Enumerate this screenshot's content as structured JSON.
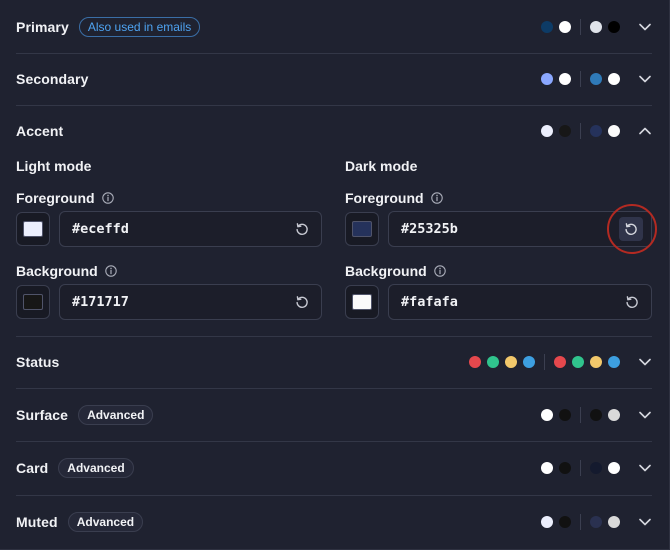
{
  "rows": {
    "primary": {
      "title": "Primary",
      "badge": "Also used in emails",
      "swatches_light": [
        "#0d3b66",
        "#ffffff"
      ],
      "swatches_dark": [
        "#dfe3ea",
        "#000000"
      ]
    },
    "secondary": {
      "title": "Secondary",
      "swatches_light": [
        "#8ba8ff",
        "#ffffff"
      ],
      "swatches_dark": [
        "#2f7ab8",
        "#ffffff"
      ]
    },
    "accent": {
      "title": "Accent",
      "swatches_light": [
        "#eceffd",
        "#171717"
      ],
      "swatches_dark": [
        "#25325b",
        "#fafafa"
      ],
      "expanded": true
    },
    "status": {
      "title": "Status",
      "swatches_light": [
        "#e5484d",
        "#30c48d",
        "#f2c86b",
        "#3d9fe0"
      ],
      "swatches_dark": [
        "#e5484d",
        "#30c48d",
        "#f2c86b",
        "#3d9fe0"
      ]
    },
    "surface": {
      "title": "Surface",
      "badge": "Advanced",
      "swatches_light": [
        "#ffffff",
        "#111111"
      ],
      "swatches_dark": [
        "#111111",
        "#d9d9d9"
      ]
    },
    "card": {
      "title": "Card",
      "badge": "Advanced",
      "swatches_light": [
        "#ffffff",
        "#111111"
      ],
      "swatches_dark": [
        "#141a2e",
        "#ffffff"
      ]
    },
    "muted": {
      "title": "Muted",
      "badge": "Advanced",
      "swatches_light": [
        "#eceffd",
        "#111111"
      ],
      "swatches_dark": [
        "#2a3150",
        "#d9d9d9"
      ]
    }
  },
  "accent_panel": {
    "light": {
      "heading": "Light mode",
      "foreground_label": "Foreground",
      "foreground_value": "#eceffd",
      "foreground_color": "#eceffd",
      "background_label": "Background",
      "background_value": "#171717",
      "background_color": "#171717"
    },
    "dark": {
      "heading": "Dark mode",
      "foreground_label": "Foreground",
      "foreground_value": "#25325b",
      "foreground_color": "#25325b",
      "background_label": "Background",
      "background_value": "#fafafa",
      "background_color": "#fafafa"
    }
  },
  "icons": {
    "chevron": "chevron-down-icon",
    "chevron_up": "chevron-up-icon",
    "info": "info-icon",
    "reset": "reset-icon"
  },
  "colors": {
    "background": "#1f2230",
    "badge_blue": "#4ea3f1",
    "highlight_ring": "#b32a22"
  }
}
